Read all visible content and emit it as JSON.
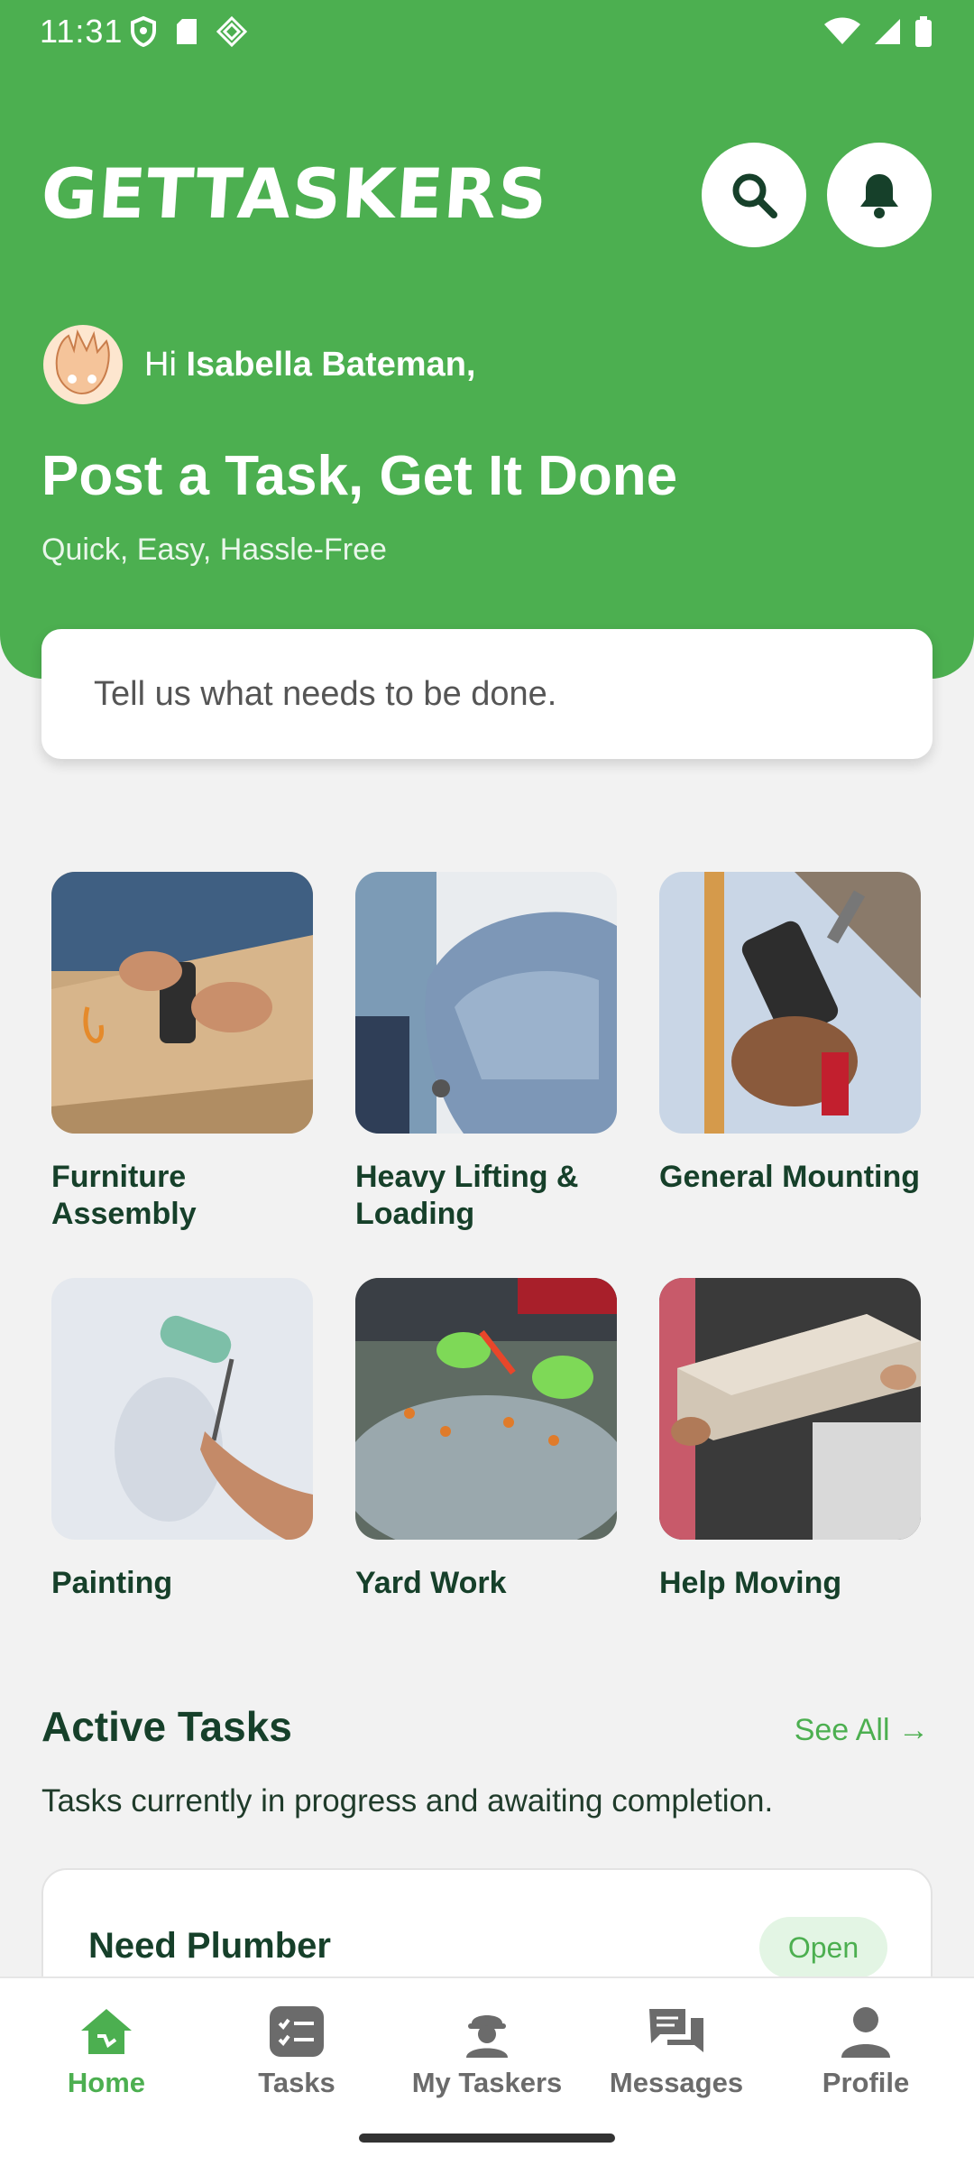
{
  "status_bar": {
    "time": "11:31"
  },
  "header": {
    "logo": "GETTASKERS",
    "search_icon": "search-icon",
    "bell_icon": "bell-icon"
  },
  "greeting": {
    "hi": "Hi",
    "name": "Isabella Bateman,"
  },
  "hero": {
    "headline": "Post a Task, Get It Done",
    "subhead": "Quick, Easy, Hassle-Free"
  },
  "task_input": {
    "placeholder": "Tell us what needs to be done."
  },
  "categories": [
    {
      "label": "Furniture Assembly"
    },
    {
      "label": "Heavy Lifting & Loading"
    },
    {
      "label": "General Mounting"
    },
    {
      "label": "Painting"
    },
    {
      "label": "Yard Work"
    },
    {
      "label": "Help Moving"
    }
  ],
  "active_tasks": {
    "title": "Active Tasks",
    "see_all": "See All →",
    "subtitle": "Tasks currently in progress and awaiting completion.",
    "items": [
      {
        "title": "Need Plumber",
        "status": "Open"
      }
    ]
  },
  "bottom_nav": [
    {
      "label": "Home",
      "icon": "home-icon",
      "active": true
    },
    {
      "label": "Tasks",
      "icon": "tasks-icon",
      "active": false
    },
    {
      "label": "My Taskers",
      "icon": "worker-icon",
      "active": false
    },
    {
      "label": "Messages",
      "icon": "messages-icon",
      "active": false
    },
    {
      "label": "Profile",
      "icon": "profile-icon",
      "active": false
    }
  ],
  "colors": {
    "brand_green": "#4caf50",
    "dark_green": "#16402a",
    "badge_bg": "#e3f5e4"
  }
}
